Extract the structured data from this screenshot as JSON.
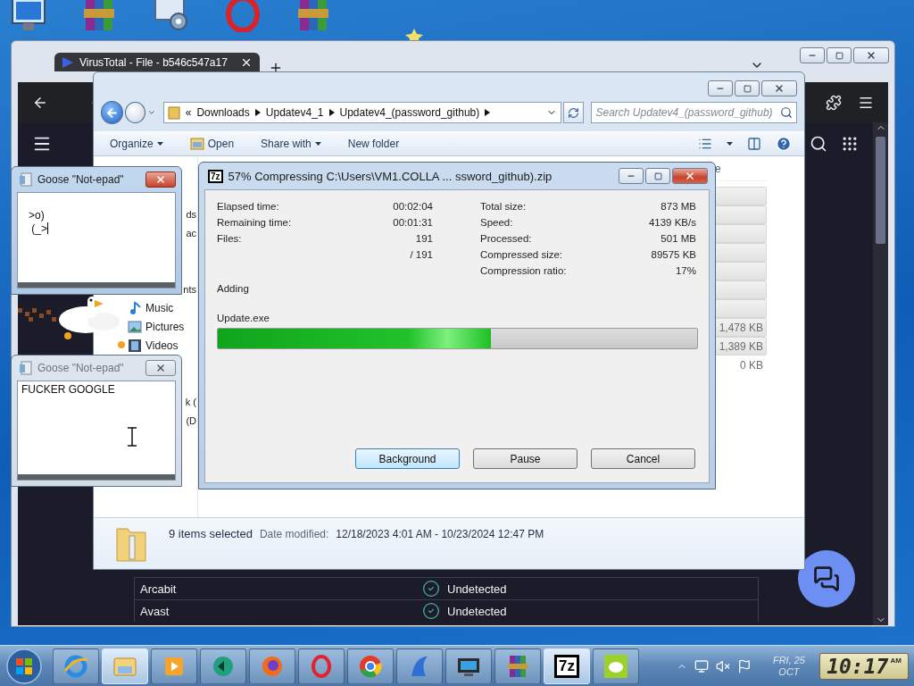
{
  "desktop": {
    "icons": [
      {
        "kind": "computer"
      },
      {
        "kind": "archive"
      },
      {
        "kind": "settings"
      },
      {
        "kind": "ring"
      },
      {
        "kind": "archive"
      }
    ]
  },
  "browser": {
    "tab_title": "VirusTotal - File - b546c547a17",
    "results": [
      {
        "engine": "Arcabit",
        "verdict": "Undetected"
      },
      {
        "engine": "Avast",
        "verdict": "Undetected"
      }
    ]
  },
  "explorer": {
    "overflow_mark": "«",
    "breadcrumb": [
      "Downloads",
      "Updatev4_1",
      "Updatev4_(password_github)"
    ],
    "search": {
      "placeholder": "Search Updatev4_(password_github)"
    },
    "commands": [
      {
        "label": "Organize",
        "kind": "menu"
      },
      {
        "label": "Open",
        "kind": "open"
      },
      {
        "label": "Share with",
        "kind": "menu"
      },
      {
        "label": "New folder",
        "kind": "plain"
      }
    ],
    "nav_groups": [
      {
        "items": [
          {
            "label": "ds",
            "kind": "text"
          },
          {
            "label": "ac",
            "kind": "text"
          }
        ]
      },
      {
        "items": [
          {
            "label": "nts",
            "kind": "text"
          },
          {
            "label": "Music",
            "kind": "music"
          },
          {
            "label": "Pictures",
            "kind": "pictures"
          },
          {
            "label": "Videos",
            "kind": "videos"
          }
        ]
      },
      {
        "items": [
          {
            "label": "k (",
            "kind": "text"
          },
          {
            "label": "(D",
            "kind": "text"
          }
        ]
      }
    ],
    "column_header": "e",
    "files": [
      {
        "selected": true
      },
      {
        "selected": true
      },
      {
        "selected": true
      },
      {
        "selected": true
      },
      {
        "selected": true
      },
      {
        "selected": true
      },
      {
        "selected": true
      },
      {
        "size": "1,478 KB",
        "selected": true
      },
      {
        "size": "1,389 KB",
        "selected": true
      },
      {
        "size": "0 KB",
        "selected": false
      }
    ],
    "details": {
      "summary": "9 items selected",
      "date_label": "Date modified:",
      "date_range": "12/18/2023 4:01 AM - 10/23/2024 12:47 PM"
    }
  },
  "compress": {
    "icon_text": "7z",
    "title": "57% Compressing C:\\Users\\VM1.COLLA ... ssword_github).zip",
    "left_stats": [
      {
        "label": "Elapsed time:",
        "value": "00:02:04"
      },
      {
        "label": "Remaining time:",
        "value": "00:01:31"
      },
      {
        "label": "Files:",
        "value": "191"
      },
      {
        "value": "/ 191"
      }
    ],
    "right_stats": [
      {
        "label": "Total size:",
        "value": "873 MB"
      },
      {
        "label": "Speed:",
        "value": "4139 KB/s"
      },
      {
        "label": "Processed:",
        "value": "501 MB"
      },
      {
        "label": "Compressed size:",
        "value": "89575 KB"
      },
      {
        "label": "Compression ratio:",
        "value": "17%"
      }
    ],
    "operation": "Adding",
    "current_file": "Update.exe",
    "progress": {
      "level": 0.57
    },
    "buttons": [
      {
        "label": "Background",
        "selected": true
      },
      {
        "label": "Pause",
        "selected": false
      },
      {
        "label": "Cancel",
        "selected": false
      }
    ]
  },
  "notepads": [
    {
      "title": "Goose \"Not-epad\"",
      "text": ">o)\n (_>",
      "active": true,
      "caret": true
    },
    {
      "title": "Goose \"Not-epad\"",
      "text": "FUCKER GOOGLE",
      "active": false,
      "caret": false
    }
  ],
  "taskbar": {
    "apps": [
      {
        "kind": "ie",
        "active": false
      },
      {
        "kind": "explorer",
        "active": true
      },
      {
        "kind": "media",
        "active": false
      },
      {
        "kind": "green",
        "active": false
      },
      {
        "kind": "firefox",
        "active": false
      },
      {
        "kind": "opera",
        "active": false
      },
      {
        "kind": "chrome",
        "active": false
      },
      {
        "kind": "shark",
        "active": false
      },
      {
        "kind": "tv",
        "active": false
      },
      {
        "kind": "winrar",
        "active": false
      },
      {
        "kind": "sevenzip",
        "text": "7z",
        "active": true
      },
      {
        "kind": "bird",
        "active": false
      }
    ],
    "clock": {
      "date": "FRI, 25",
      "month": "OCT",
      "time": "10:17",
      "ampm": "AM"
    }
  }
}
